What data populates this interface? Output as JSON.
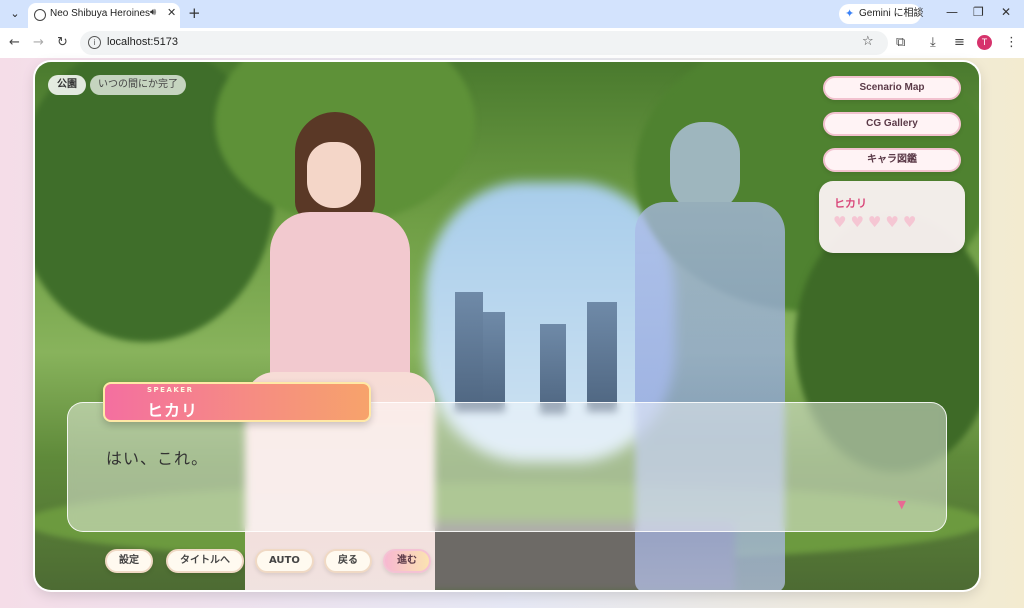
{
  "browser": {
    "tab_title": "Neo Shibuya Heroines",
    "url": "localhost:5173",
    "gemini_label": "Gemini に相談",
    "profile_initial": "T"
  },
  "scene": {
    "location": "公園",
    "status": "いつの間にか完了"
  },
  "menu": {
    "scenario_map": "Scenario Map",
    "cg_gallery": "CG Gallery",
    "character_dex": "キャラ図鑑"
  },
  "affinity": {
    "name": "ヒカリ",
    "level": 0,
    "max": 5
  },
  "dialogue": {
    "speaker_tag": "SPEAKER",
    "speaker_name": "ヒカリ",
    "text": "はい、これ。"
  },
  "controls": {
    "settings": "設定",
    "title": "タイトルへ",
    "auto": "AUTO",
    "back": "戻る",
    "next": "進む"
  },
  "colors": {
    "accent_pink": "#f46fa0",
    "accent_orange": "#f7a36b",
    "heart": "#f5c6d3"
  }
}
